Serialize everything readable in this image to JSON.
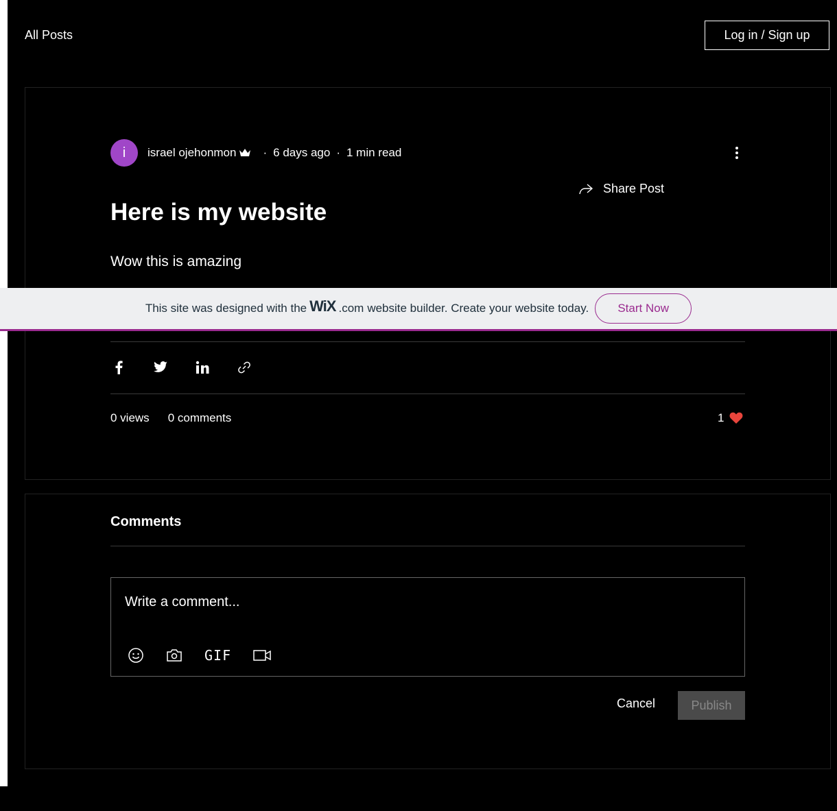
{
  "header": {
    "all_posts": "All Posts",
    "login": "Log in / Sign up"
  },
  "post": {
    "author_initial": "i",
    "author": "israel ojehonmon",
    "separator": "·",
    "date": "6 days ago",
    "read_time": "1 min read",
    "share_post": "Share Post",
    "title": "Here is my website",
    "body": "Wow this is amazing",
    "views": "0 views",
    "comments_count": "0 comments",
    "likes": "1"
  },
  "banner": {
    "text_before": "This site was designed with the",
    "logo": "WiX",
    "logo_suffix": ".com",
    "text_after": "website builder. Create your website today.",
    "cta": "Start Now"
  },
  "comments": {
    "title": "Comments",
    "placeholder": "Write a comment...",
    "gif_label": "GIF",
    "cancel": "Cancel",
    "publish": "Publish"
  },
  "colors": {
    "avatar": "#a046c8",
    "wix_accent": "#9a2b8f",
    "heart": "#e8453c"
  }
}
